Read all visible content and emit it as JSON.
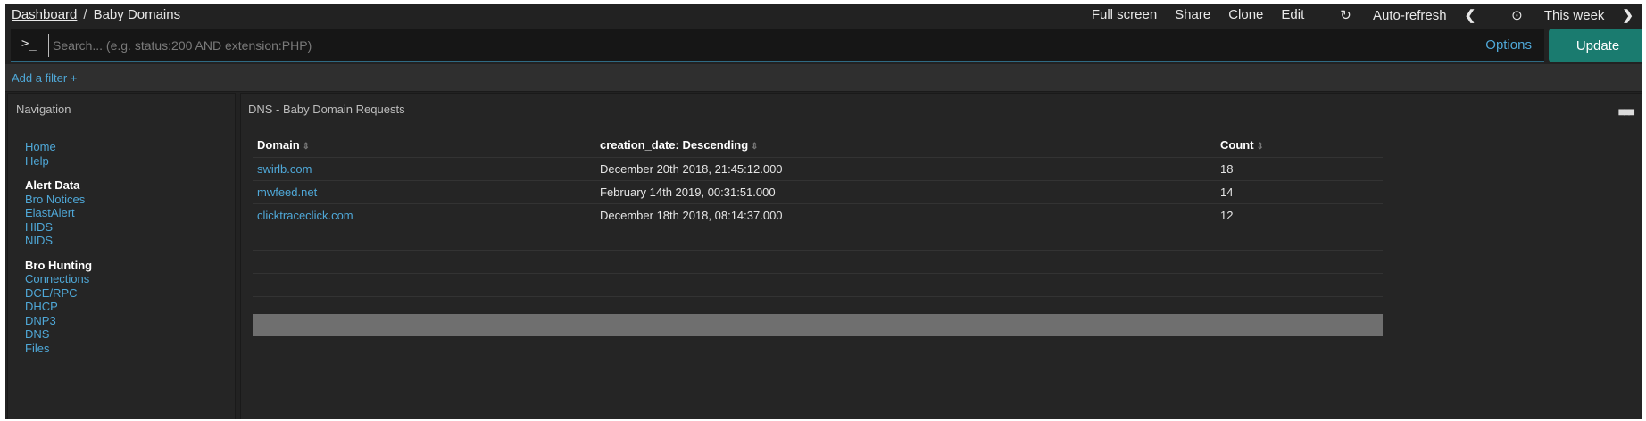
{
  "breadcrumb": {
    "root": "Dashboard",
    "separator": "/",
    "current": "Baby Domains"
  },
  "topnav": {
    "full_screen": "Full screen",
    "share": "Share",
    "clone": "Clone",
    "edit": "Edit",
    "auto_refresh": "Auto-refresh",
    "prev": "❮",
    "time_range": "This week",
    "next": "❯"
  },
  "query": {
    "prompt": ">_",
    "placeholder": "Search... (e.g. status:200 AND extension:PHP)",
    "options": "Options",
    "update": "Update"
  },
  "filter": {
    "add": "Add a filter +"
  },
  "navigation": {
    "title": "Navigation",
    "links_top": [
      "Home",
      "Help"
    ],
    "alert_header": "Alert Data",
    "alert_links": [
      "Bro Notices",
      "ElastAlert",
      "HIDS",
      "NIDS"
    ],
    "hunt_header": "Bro Hunting",
    "hunt_links": [
      "Connections",
      "DCE/RPC",
      "DHCP",
      "DNP3",
      "DNS",
      "Files"
    ]
  },
  "results": {
    "title": "DNS - Baby Domain Requests",
    "columns": [
      "Domain",
      "creation_date: Descending",
      "Count"
    ],
    "rows": [
      {
        "domain": "swirlb.com",
        "date": "December 20th 2018, 21:45:12.000",
        "count": "18"
      },
      {
        "domain": "mwfeed.net",
        "date": "February 14th 2019, 00:31:51.000",
        "count": "14"
      },
      {
        "domain": "clicktraceclick.com",
        "date": "December 18th 2018, 08:14:37.000",
        "count": "12"
      }
    ]
  },
  "colors": {
    "accent": "#4fa8d8",
    "update_button": "#1a7b6f",
    "background": "#222222"
  }
}
